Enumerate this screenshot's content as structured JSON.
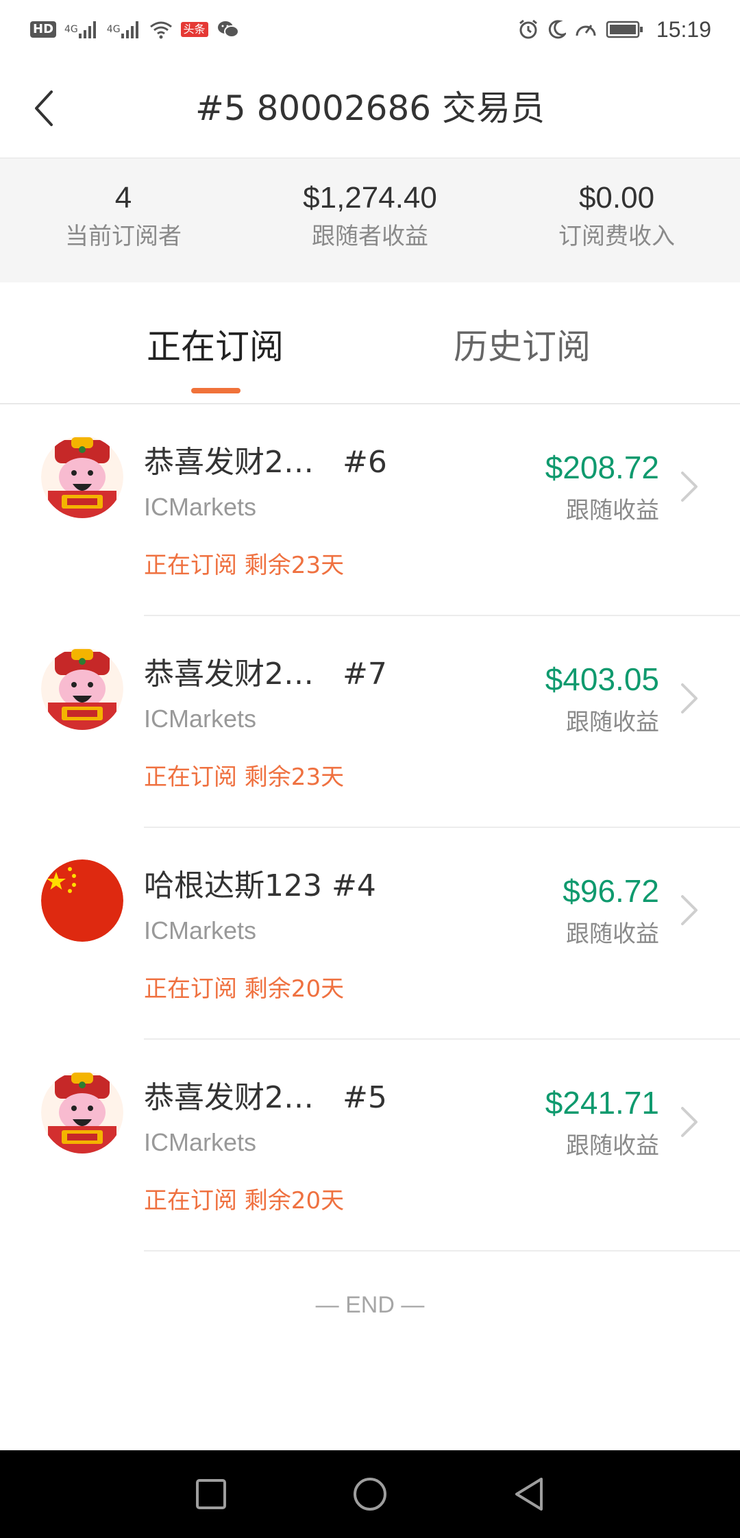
{
  "status_bar": {
    "hd": "HD",
    "net1": "4G",
    "net2": "4G",
    "toutiao": "头条",
    "time": "15:19",
    "icons": [
      "hd-icon",
      "signal-icon",
      "signal-icon",
      "wifi-icon",
      "toutiao-icon",
      "wechat-icon",
      "alarm-icon",
      "moon-icon",
      "speed-icon",
      "battery-icon"
    ]
  },
  "header": {
    "title": "#5 80002686 交易员",
    "back_icon": "chevron-left-icon"
  },
  "stats": [
    {
      "value": "4",
      "label": "当前订阅者"
    },
    {
      "value": "$1,274.40",
      "label": "跟随者收益"
    },
    {
      "value": "$0.00",
      "label": "订阅费收入"
    }
  ],
  "tabs": {
    "active": "正在订阅",
    "history": "历史订阅"
  },
  "colors": {
    "accent": "#f0723a",
    "profit_green": "#0f9a6e",
    "status_orange": "#ef7140"
  },
  "subscriptions": [
    {
      "name": "恭喜发财2…   #6",
      "broker": "ICMarkets",
      "amount": "$208.72",
      "amount_label": "跟随收益",
      "status": "正在订阅 剩余23天",
      "avatar": "caishen-avatar"
    },
    {
      "name": "恭喜发财2…   #7",
      "broker": "ICMarkets",
      "amount": "$403.05",
      "amount_label": "跟随收益",
      "status": "正在订阅 剩余23天",
      "avatar": "caishen-avatar"
    },
    {
      "name": "哈根达斯123 #4",
      "broker": "ICMarkets",
      "amount": "$96.72",
      "amount_label": "跟随收益",
      "status": "正在订阅 剩余20天",
      "avatar": "china-flag-avatar"
    },
    {
      "name": "恭喜发财2…   #5",
      "broker": "ICMarkets",
      "amount": "$241.71",
      "amount_label": "跟随收益",
      "status": "正在订阅 剩余20天",
      "avatar": "caishen-avatar"
    }
  ],
  "end_text": "— END —",
  "system_nav": [
    "square-icon",
    "circle-icon",
    "triangle-back-icon"
  ]
}
